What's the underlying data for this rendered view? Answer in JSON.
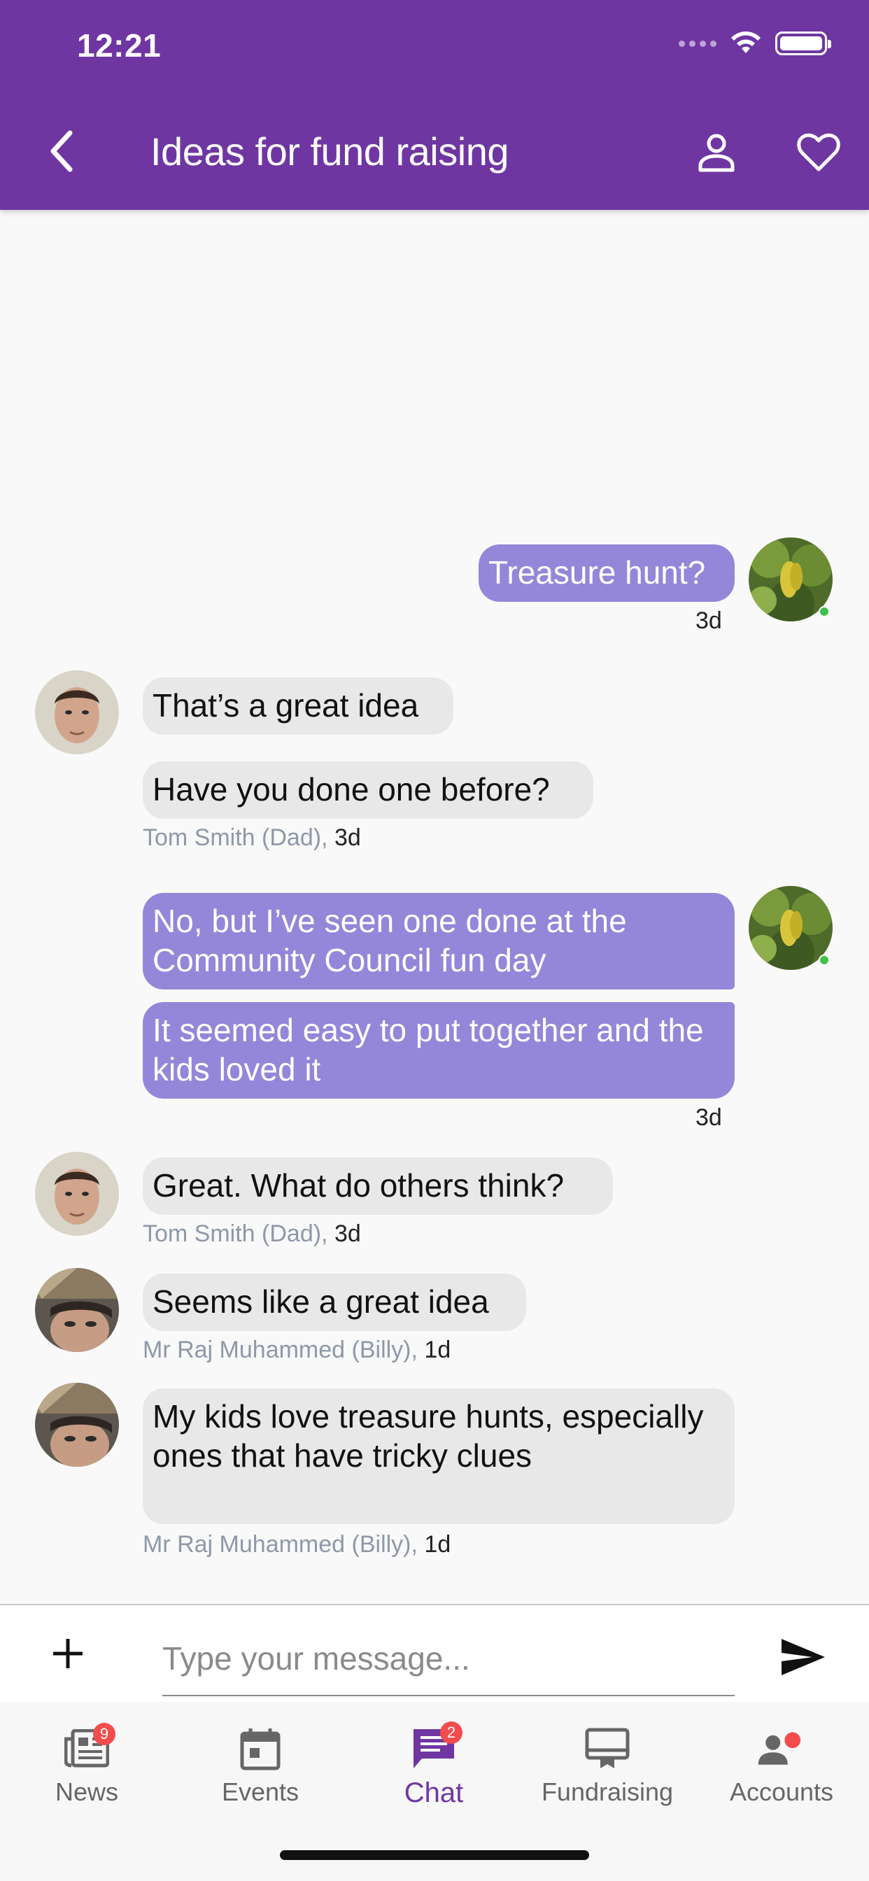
{
  "status_bar": {
    "time": "12:21"
  },
  "header": {
    "title": "Ideas for fund raising",
    "back_icon": "chevron-left-icon",
    "profile_icon": "person-icon",
    "favorite_icon": "heart-outline-icon"
  },
  "colors": {
    "brand": "#6f36a2",
    "outgoing_bubble": "#9486d8",
    "incoming_bubble": "#e8e8e8",
    "badge": "#f44c4c",
    "online": "#3ec24c"
  },
  "messages": [
    {
      "text": "Treasure hunt?",
      "direction": "outgoing"
    },
    {
      "text": "That’s a great idea",
      "direction": "incoming"
    },
    {
      "text": "Have you done one before?",
      "direction": "incoming"
    },
    {
      "text": "No, but I’ve seen one done at the Community Council fun day",
      "direction": "outgoing"
    },
    {
      "text": "It seemed easy to put together and the kids loved it",
      "direction": "outgoing"
    },
    {
      "text": "Great. What do others think?",
      "direction": "incoming"
    },
    {
      "text": "Seems like a great idea",
      "direction": "incoming"
    },
    {
      "text": "My kids love treasure hunts, especially ones that have tricky clues",
      "direction": "incoming"
    }
  ],
  "groups": [
    {
      "time": "3d"
    },
    {
      "sender": "Tom Smith (Dad),",
      "time": "3d"
    },
    {
      "time": "3d"
    },
    {
      "sender": "Tom Smith (Dad),",
      "time": "3d"
    },
    {
      "sender": "Mr Raj Muhammed (Billy),",
      "time": "1d"
    },
    {
      "sender": "Mr Raj Muhammed (Billy),",
      "time": "1d"
    }
  ],
  "composer": {
    "placeholder": "Type your message...",
    "add_icon": "plus-icon",
    "send_icon": "send-icon"
  },
  "tabs": [
    {
      "label": "News",
      "icon": "newspaper-icon",
      "badge": "9"
    },
    {
      "label": "Events",
      "icon": "calendar-icon"
    },
    {
      "label": "Chat",
      "icon": "chat-icon",
      "badge": "2",
      "active": true
    },
    {
      "label": "Fundraising",
      "icon": "fundraising-icon"
    },
    {
      "label": "Accounts",
      "icon": "accounts-icon"
    }
  ]
}
